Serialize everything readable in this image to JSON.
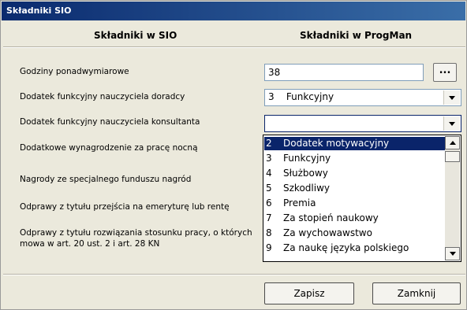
{
  "window": {
    "title": "Składniki SIO"
  },
  "headers": {
    "left": "Składniki w SIO",
    "right": "Składniki w ProgMan"
  },
  "rows": [
    {
      "label": "Godziny ponadwymiarowe",
      "value": "38",
      "button": "..."
    },
    {
      "label": "Dodatek funkcyjny nauczyciela doradcy",
      "value": "3    Funkcyjny"
    },
    {
      "label": "Dodatek funkcyjny nauczyciela konsultanta",
      "value": ""
    },
    {
      "label": "Dodatkowe wynagrodzenie za pracę nocną"
    },
    {
      "label": "Nagrody ze specjalnego funduszu nagród"
    },
    {
      "label": "Odprawy z tytułu przejścia na emeryturę lub rentę"
    },
    {
      "label": "Odprawy z tytułu rozwiązania stosunku pracy, o których mowa w art. 20 ust. 2 i art. 28 KN"
    }
  ],
  "dropdown": {
    "items": [
      {
        "num": "2",
        "text": "Dodatek motywacyjny"
      },
      {
        "num": "3",
        "text": "Funkcyjny"
      },
      {
        "num": "4",
        "text": "Służbowy"
      },
      {
        "num": "5",
        "text": "Szkodliwy"
      },
      {
        "num": "6",
        "text": "Premia"
      },
      {
        "num": "7",
        "text": "Za stopień naukowy"
      },
      {
        "num": "8",
        "text": "Za wychowawstwo"
      },
      {
        "num": "9",
        "text": "Za naukę języka polskiego"
      }
    ],
    "selected_index": 0
  },
  "footer": {
    "save_label": "Zapisz",
    "close_label": "Zamknij"
  },
  "colors": {
    "titlebar": "#0a2a6e",
    "selection": "#0a246a",
    "panel": "#ebe9dc"
  }
}
